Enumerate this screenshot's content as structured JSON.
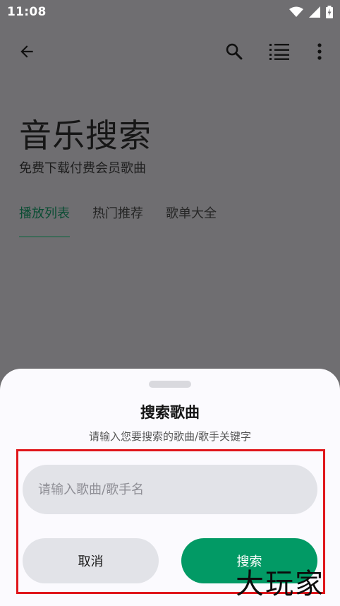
{
  "status_bar": {
    "time": "11:08",
    "icons": [
      "wifi-icon",
      "signal-icon",
      "battery-charging-icon"
    ]
  },
  "app_bar": {
    "icons": [
      "back-arrow-icon",
      "search-icon",
      "playlist-icon",
      "more-vert-icon"
    ]
  },
  "header": {
    "title": "音乐搜索",
    "subtitle": "免费下载付费会员歌曲"
  },
  "tabs": [
    {
      "label": "播放列表",
      "active": true
    },
    {
      "label": "热门推荐",
      "active": false
    },
    {
      "label": "歌单大全",
      "active": false
    }
  ],
  "dialog": {
    "title": "搜索歌曲",
    "subtitle": "请输入您要搜索的歌曲/歌手关键字",
    "input": {
      "value": "",
      "placeholder": "请输入歌曲/歌手名"
    },
    "cancel_label": "取消",
    "confirm_label": "搜索"
  },
  "watermark": {
    "text": "大玩家"
  },
  "colors": {
    "accent": "#029a65",
    "active_tab": "#0b4d34",
    "highlight": "#e0161b",
    "scrim": "#6f6e71",
    "sheet_bg": "#fbfafe",
    "field_bg": "#e2e3e8"
  }
}
